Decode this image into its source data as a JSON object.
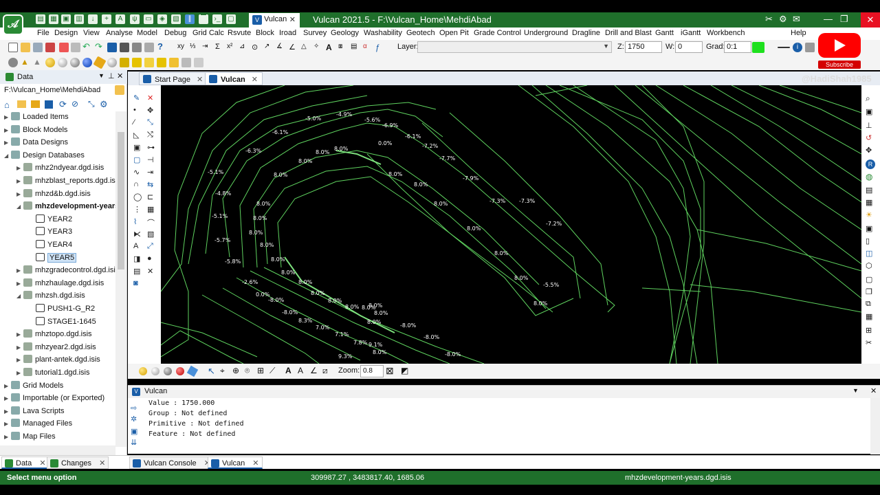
{
  "app": {
    "title": "Vulcan 2021.5 - F:\\Vulcan_Home\\MehdiAbad",
    "tab_label": "Vulcan",
    "logo_glyph": "𝒜"
  },
  "menu": [
    "File",
    "Design",
    "View",
    "Analyse",
    "Model",
    "Debug",
    "Grid Calc",
    "Rsvute",
    "Block",
    "Iroad",
    "Survey",
    "Geology",
    "Washability",
    "Geotech",
    "Open Pit",
    "Grade Control",
    "Underground",
    "Dragline",
    "Drill and Blast",
    "Gantt",
    "iGantt",
    "Workbench",
    "Help"
  ],
  "toolbar": {
    "layer_label": "Layer:",
    "layer_value": "",
    "z_label": "Z:",
    "z_value": "1750",
    "w_label": "W:",
    "w_value": "0",
    "grad_label": "Grad:",
    "grad_value": "0:1"
  },
  "overlay": {
    "subscribe": "Subscribe",
    "watermark": "@HadiShah1985"
  },
  "data_panel": {
    "title": "Data",
    "path": "F:\\Vulcan_Home\\MehdiAbad",
    "tree": [
      {
        "label": "Loaded Items",
        "level": 0,
        "expander": "▶"
      },
      {
        "label": "Block Models",
        "level": 0,
        "expander": "▶"
      },
      {
        "label": "Data Designs",
        "level": 0,
        "expander": "▶"
      },
      {
        "label": "Design Databases",
        "level": 0,
        "expander": "◢"
      },
      {
        "label": "mhz2ndyear.dgd.isis",
        "level": 1,
        "expander": "▶"
      },
      {
        "label": "mhzblast_reports.dgd.isis",
        "level": 1,
        "expander": "▶"
      },
      {
        "label": "mhzd&b.dgd.isis",
        "level": 1,
        "expander": "▶"
      },
      {
        "label": "mhzdevelopment-years.",
        "level": 1,
        "expander": "◢",
        "bold": true
      },
      {
        "label": "YEAR2",
        "level": 2,
        "expander": ""
      },
      {
        "label": "YEAR3",
        "level": 2,
        "expander": ""
      },
      {
        "label": "YEAR4",
        "level": 2,
        "expander": ""
      },
      {
        "label": "YEAR5",
        "level": 2,
        "expander": "",
        "selected": true
      },
      {
        "label": "mhzgradecontrol.dgd.isis",
        "level": 1,
        "expander": "▶"
      },
      {
        "label": "mhzhaulage.dgd.isis",
        "level": 1,
        "expander": "▶"
      },
      {
        "label": "mhzsh.dgd.isis",
        "level": 1,
        "expander": "◢"
      },
      {
        "label": "PUSH1-G_R2",
        "level": 2,
        "expander": ""
      },
      {
        "label": "STAGE1-1645",
        "level": 2,
        "expander": ""
      },
      {
        "label": "mhztopo.dgd.isis",
        "level": 1,
        "expander": "▶"
      },
      {
        "label": "mhzyear2.dgd.isis",
        "level": 1,
        "expander": "▶"
      },
      {
        "label": "plant-antek.dgd.isis",
        "level": 1,
        "expander": "▶"
      },
      {
        "label": "tutorial1.dgd.isis",
        "level": 1,
        "expander": "▶"
      },
      {
        "label": "Grid Models",
        "level": 0,
        "expander": "▶"
      },
      {
        "label": "Importable (or Exported)",
        "level": 0,
        "expander": "▶"
      },
      {
        "label": "Lava Scripts",
        "level": 0,
        "expander": "▶"
      },
      {
        "label": "Managed Files",
        "level": 0,
        "expander": "▶"
      },
      {
        "label": "Map Files",
        "level": 0,
        "expander": "▶"
      }
    ]
  },
  "view_tabs": [
    "Start Page",
    "Vulcan"
  ],
  "canvas": {
    "grade_labels": [
      "-5.0%",
      "-4.9%",
      "-5.6%",
      "-6.9%",
      "-6.1%",
      "-6.1%",
      "-6.3%",
      "-7.2%",
      "-7.7%",
      "-7.9%",
      "-7.3%",
      "-7.3%",
      "-7.2%",
      "-5.5%",
      "-5.1%",
      "-4.8%",
      "-5.1%",
      "-5.7%",
      "-5.8%",
      "-2.6%",
      "0.0%",
      "0.0%",
      "8.0%",
      "8.0%",
      "8.0%",
      "8.0%",
      "8.0%",
      "8.0%",
      "8.0%",
      "8.0%",
      "8.0%",
      "8.0%",
      "8.0%",
      "8.0%",
      "8.0%",
      "8.0%",
      "8.0%",
      "8.0%",
      "8.0%",
      "8.0%",
      "8.0%",
      "8.0%",
      "8.0%",
      "8.0%",
      "8.0%",
      "8.0%",
      "8.0%",
      "-8.0%",
      "-8.0%",
      "-8.0%",
      "-8.0%",
      "-8.0%",
      "8.3%",
      "7.0%",
      "7.1%",
      "7.8%",
      "8.0%",
      "9.1%",
      "9.3%"
    ]
  },
  "canvas_toolbar": {
    "zoom_label": "Zoom:",
    "zoom_value": "0.8"
  },
  "console": {
    "title": "Vulcan",
    "lines": [
      "Value     : 1750.000",
      "Group     : Not defined",
      "Primitive : Not defined",
      "Feature   : Not defined"
    ]
  },
  "bottom_tabs": {
    "left": [
      "Data",
      "Changes"
    ],
    "right": [
      "Vulcan Console",
      "Vulcan"
    ]
  },
  "status": {
    "message": "Select menu option",
    "coords": "309987.27 , 3483817.40, 1685.06",
    "file": "mhzdevelopment-years.dgd.isis"
  },
  "colors": {
    "brand_green": "#1f6f2b",
    "contour_green": "#5fd35f",
    "accent_blue": "#1a5ea8"
  }
}
